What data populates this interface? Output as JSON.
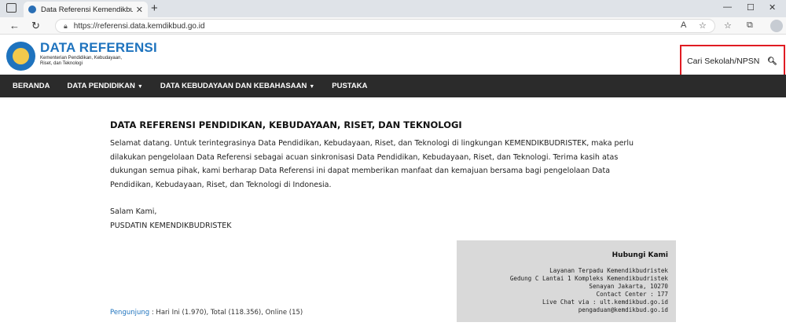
{
  "browser": {
    "tab_title": "Data Referensi Kemendikbudristek",
    "url": "https://referensi.data.kemdikbud.go.id"
  },
  "header": {
    "brand_title": "DATA REFERENSI",
    "brand_subtitle": "Kementerian Pendidikan, Kebudayaan, Riset, dan Teknologi",
    "search_label": "Cari Sekolah/NPSN"
  },
  "nav": {
    "items": [
      {
        "label": "BERANDA"
      },
      {
        "label": "DATA PENDIDIKAN"
      },
      {
        "label": "DATA KEBUDAYAAN DAN KEBAHASAAN"
      },
      {
        "label": "PUSTAKA"
      }
    ]
  },
  "main": {
    "heading": "DATA REFERENSI PENDIDIKAN, KEBUDAYAAN, RISET, DAN TEKNOLOGI",
    "paragraph": "Selamat datang. Untuk terintegrasinya Data Pendidikan, Kebudayaan, Riset, dan Teknologi di lingkungan KEMENDIKBUDRISTEK, maka perlu dilakukan pengelolaan Data Referensi sebagai acuan sinkronisasi Data Pendidikan, Kebudayaan, Riset, dan Teknologi. Terima kasih atas dukungan semua pihak, kami berharap Data Referensi ini dapat memberikan manfaat dan kemajuan bersama bagi pengelolaan Data Pendidikan, Kebudayaan, Riset, dan Teknologi di Indonesia.",
    "salam": "Salam Kami,",
    "signature": "PUSDATIN KEMENDIKBUDRISTEK"
  },
  "contact": {
    "heading": "Hubungi Kami",
    "lines": [
      "Layanan Terpadu Kemendikbudristek",
      "Gedung C Lantai 1 Kompleks Kemendikbudristek",
      "Senayan Jakarta, 10270",
      "Contact Center : 177",
      "Live Chat via : ult.kemdikbud.go.id pengaduan@kemdikbud.go.id"
    ]
  },
  "visitors": {
    "label": "Pengunjung",
    "text": " : Hari Ini (1.970), Total (118.356), Online (15)"
  }
}
